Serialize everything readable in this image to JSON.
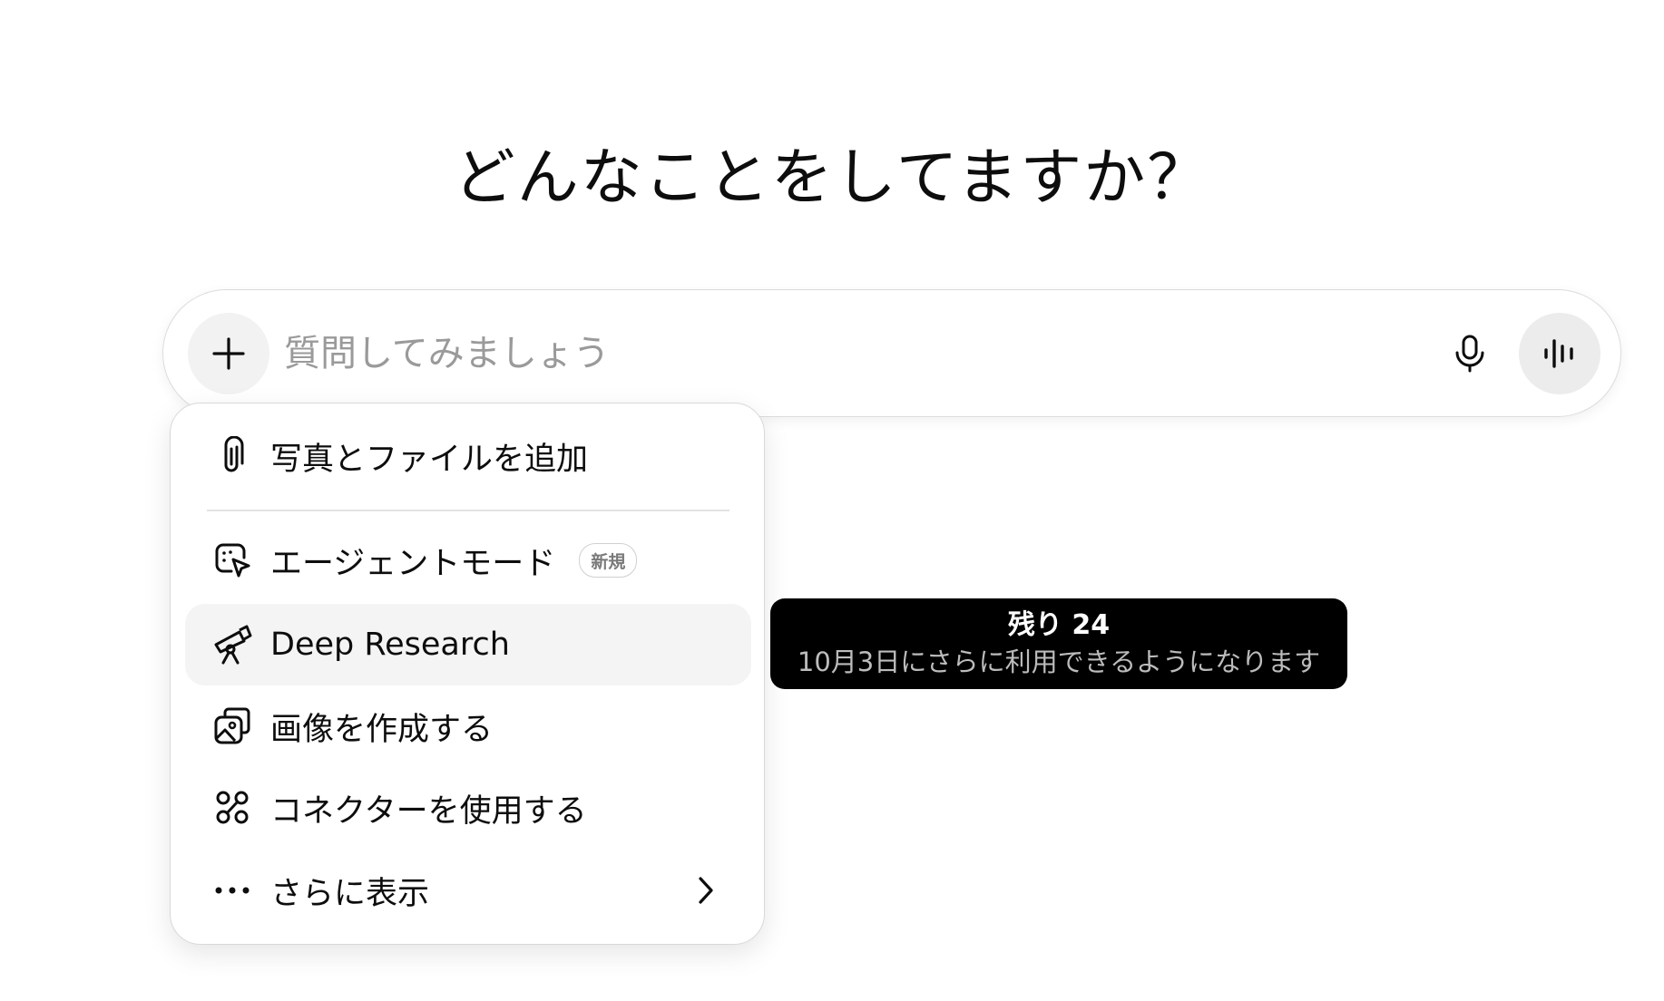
{
  "headline": "どんなことをしてますか？",
  "composer": {
    "placeholder": "質問してみましょう",
    "plus_icon": "plus-icon",
    "mic_icon": "microphone-icon",
    "voice_icon": "voice-waveform-icon"
  },
  "menu": {
    "items": [
      {
        "label": "写真とファイルを追加",
        "icon": "paperclip-icon"
      },
      {
        "label": "エージェントモード",
        "icon": "agent-cursor-icon",
        "badge": "新規"
      },
      {
        "label": "Deep Research",
        "icon": "telescope-icon"
      },
      {
        "label": "画像を作成する",
        "icon": "image-icon"
      },
      {
        "label": "コネクターを使用する",
        "icon": "connectors-icon"
      },
      {
        "label": "さらに表示",
        "icon": "more-dots-icon",
        "trailing_icon": "chevron-right-icon"
      }
    ]
  },
  "tooltip": {
    "title": "残り 24",
    "subtitle": "10月3日にさらに利用できるようになります"
  }
}
